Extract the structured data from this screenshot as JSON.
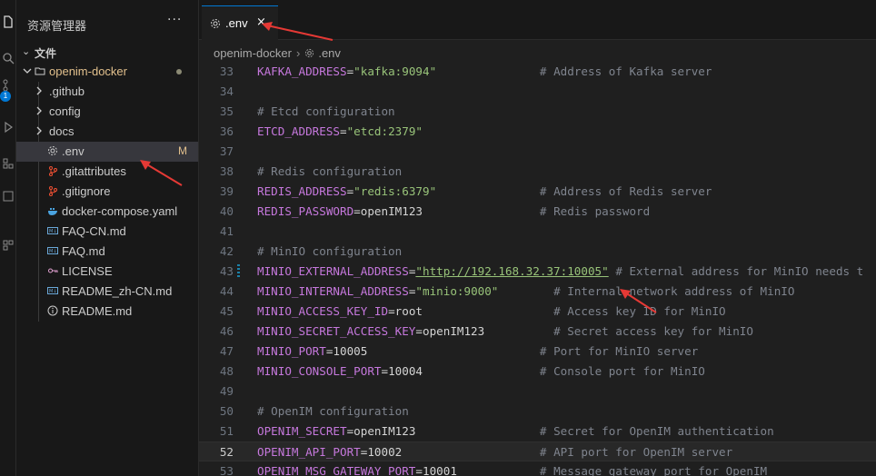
{
  "activity": {
    "badge": "1",
    "icons": [
      "explorer-icon",
      "search-icon",
      "source-control-icon",
      "run-debug-icon",
      "extensions-icon",
      "remote-icon",
      "testing-icon"
    ]
  },
  "sidebar": {
    "title": "资源管理器",
    "more": "···",
    "section": "文件",
    "root": "openim-docker",
    "items": [
      {
        "name": ".github",
        "type": "folder"
      },
      {
        "name": "config",
        "type": "folder"
      },
      {
        "name": "docs",
        "type": "folder"
      },
      {
        "name": ".env",
        "type": "gear",
        "status": "M",
        "selected": true
      },
      {
        "name": ".gitattributes",
        "type": "git"
      },
      {
        "name": ".gitignore",
        "type": "git"
      },
      {
        "name": "docker-compose.yaml",
        "type": "docker"
      },
      {
        "name": "FAQ-CN.md",
        "type": "md"
      },
      {
        "name": "FAQ.md",
        "type": "md"
      },
      {
        "name": "LICENSE",
        "type": "license"
      },
      {
        "name": "README_zh-CN.md",
        "type": "md"
      },
      {
        "name": "README.md",
        "type": "info"
      }
    ]
  },
  "tab": {
    "label": ".env",
    "close": "×"
  },
  "breadcrumb": {
    "folder": "openim-docker",
    "sep": "›",
    "file": ".env"
  },
  "colors": {
    "accent": "#0078d4",
    "annotation_arrow": "#e53935",
    "modified": "#e2c08d"
  },
  "code": [
    {
      "n": "33",
      "key": "KAFKA_ADDRESS",
      "val": "\"kafka:9094\"",
      "valtype": "s",
      "pad": "               ",
      "comment": "# Address of Kafka server"
    },
    {
      "n": "34"
    },
    {
      "n": "35",
      "comment": "# Etcd configuration"
    },
    {
      "n": "36",
      "key": "ETCD_ADDRESS",
      "val": "\"etcd:2379\"",
      "valtype": "s"
    },
    {
      "n": "37"
    },
    {
      "n": "38",
      "comment": "# Redis configuration"
    },
    {
      "n": "39",
      "key": "REDIS_ADDRESS",
      "val": "\"redis:6379\"",
      "valtype": "s",
      "pad": "               ",
      "comment": "# Address of Redis server"
    },
    {
      "n": "40",
      "key": "REDIS_PASSWORD",
      "val": "openIM123",
      "valtype": "v",
      "pad": "                 ",
      "comment": "# Redis password"
    },
    {
      "n": "41"
    },
    {
      "n": "42",
      "comment": "# MinIO configuration"
    },
    {
      "n": "43",
      "key": "MINIO_EXTERNAL_ADDRESS",
      "val": "\"http://192.168.32.37:10005\"",
      "valtype": "url",
      "pad": " ",
      "comment": "# External address for MinIO needs t",
      "mark": true
    },
    {
      "n": "44",
      "key": "MINIO_INTERNAL_ADDRESS",
      "val": "\"minio:9000\"",
      "valtype": "s",
      "pad": "        ",
      "comment": "# Internal network address of MinIO"
    },
    {
      "n": "45",
      "key": "MINIO_ACCESS_KEY_ID",
      "val": "root",
      "valtype": "v",
      "pad": "                   ",
      "comment": "# Access key ID for MinIO"
    },
    {
      "n": "46",
      "key": "MINIO_SECRET_ACCESS_KEY",
      "val": "openIM123",
      "valtype": "v",
      "pad": "          ",
      "comment": "# Secret access key for MinIO"
    },
    {
      "n": "47",
      "key": "MINIO_PORT",
      "val": "10005",
      "valtype": "v",
      "pad": "                         ",
      "comment": "# Port for MinIO server"
    },
    {
      "n": "48",
      "key": "MINIO_CONSOLE_PORT",
      "val": "10004",
      "valtype": "v",
      "pad": "                 ",
      "comment": "# Console port for MinIO"
    },
    {
      "n": "49"
    },
    {
      "n": "50",
      "comment": "# OpenIM configuration"
    },
    {
      "n": "51",
      "key": "OPENIM_SECRET",
      "val": "openIM123",
      "valtype": "v",
      "pad": "                  ",
      "comment": "# Secret for OpenIM authentication"
    },
    {
      "n": "52",
      "key": "OPENIM_API_PORT",
      "val": "10002",
      "valtype": "v",
      "pad": "                    ",
      "comment": "# API port for OpenIM server",
      "current": true
    },
    {
      "n": "53",
      "key": "OPENIM_MSG_GATEWAY_PORT",
      "val": "10001",
      "valtype": "v",
      "pad": "            ",
      "comment": "# Message gateway port for OpenIM"
    }
  ]
}
